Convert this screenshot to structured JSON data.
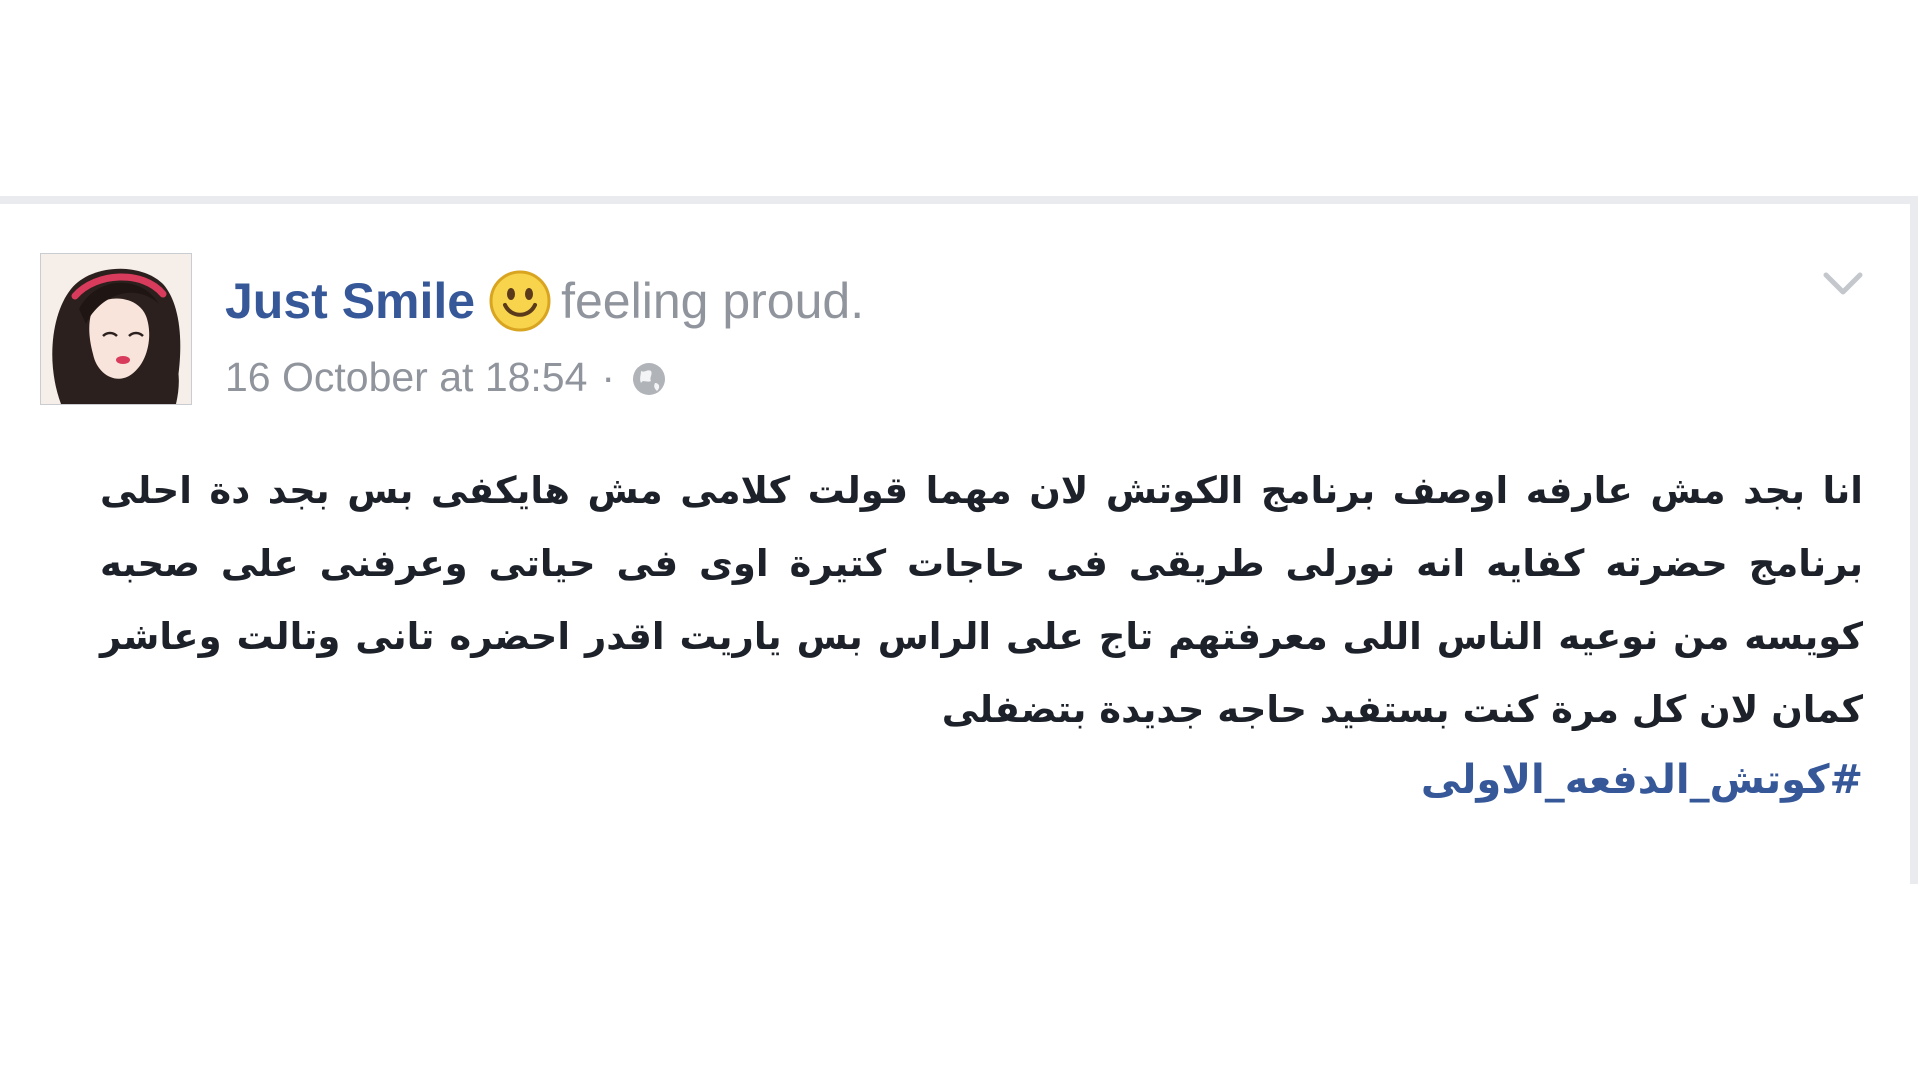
{
  "post": {
    "author": "Just Smile",
    "feeling": "feeling proud.",
    "timestamp": "16 October at 18:54",
    "separator": "·",
    "privacy_icon": "globe-icon",
    "menu_icon": "chevron-down-icon",
    "body": "انا بجد مش عارفه اوصف برنامج الكوتش لان مهما قولت كلامى مش هايكفى بس بجد دة احلى برنامج حضرته كفايه انه نورلى طريقى فى حاجات كتيرة اوى فى حياتى وعرفنى على صحبه كويسه من نوعيه الناس اللى معرفتهم تاج على الراس بس ياريت اقدر احضره تانى وتالت وعاشر كمان لان كل مرة كنت بستفيد حاجه جديدة بتضفلى",
    "hashtag": "#كوتش_الدفعه_الاولى"
  },
  "colors": {
    "link": "#365899",
    "meta": "#90949c",
    "text": "#1d2129",
    "frame": "#e9ebee"
  }
}
